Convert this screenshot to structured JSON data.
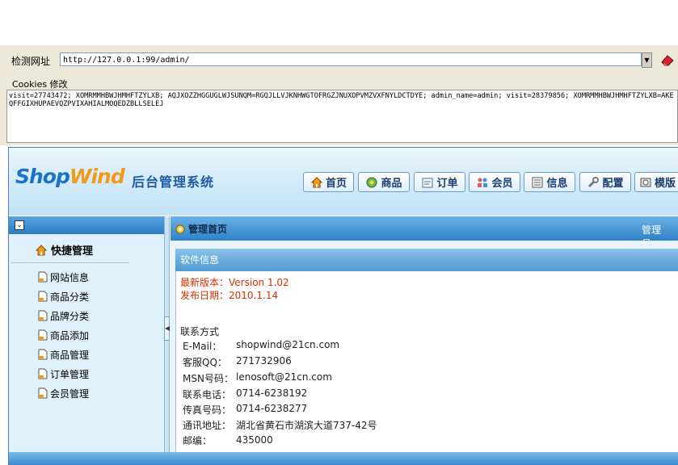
{
  "tool": {
    "url_label": "检测网址",
    "url_value": "http://127.0.0.1:99/admin/",
    "cookie_label": "Cookies 修改",
    "cookie_value": "visit=27743472; XOMRMMHBWJHMHFTZYLXB; AQJXOZZHGGUGLWJSUNQM=RGQJLLVJKNHWGTOFRGZJNUXOPVMZVXFNYLDCTDYE; admin_name=admin; visit=28379856; XOMRMMHBWJHMHFTZYLXB=AKEQFFGIXHUPAEVQZPVIXAHIALMOQEDZBLLSELEJ"
  },
  "header": {
    "logo_shop": "Shop",
    "logo_wind": "Wind",
    "system_title": "后台管理系统",
    "nav": [
      {
        "label": "首页",
        "icon": "home-icon"
      },
      {
        "label": "商品",
        "icon": "goods-icon"
      },
      {
        "label": "订单",
        "icon": "order-icon"
      },
      {
        "label": "会员",
        "icon": "members-icon"
      },
      {
        "label": "信息",
        "icon": "info-icon"
      },
      {
        "label": "配置",
        "icon": "wrench-icon"
      },
      {
        "label": "模版",
        "icon": "template-icon"
      }
    ]
  },
  "sidebar": {
    "toggle": "⊙",
    "quick_title": "快捷管理",
    "items": [
      "网站信息",
      "商品分类",
      "品牌分类",
      "商品添加",
      "商品管理",
      "订单管理",
      "会员管理"
    ]
  },
  "main": {
    "title": "管理首页",
    "admin_label": "管理员：",
    "panel_title": "软件信息",
    "version_label": "最新版本：",
    "version_value": "Version 1.02",
    "date_label": "发布日期：",
    "date_value": "2010.1.14",
    "contact_title": "联系方式",
    "contacts": [
      {
        "label": "E-Mail：",
        "value": "shopwind@21cn.com"
      },
      {
        "label": "客服QQ：",
        "value": "271732906"
      },
      {
        "label": "MSN号码：",
        "value": "lenosoft@21cn.com"
      },
      {
        "label": "联系电话：",
        "value": "0714-6238192"
      },
      {
        "label": "传真号码：",
        "value": "0714-6238277"
      },
      {
        "label": "通讯地址：",
        "value": "湖北省黄石市湖滨大道737-42号"
      },
      {
        "label": "邮编：",
        "value": "435000"
      }
    ]
  },
  "colors": {
    "accent": "#2f81c6",
    "red_text": "#d43200",
    "logo_orange": "#f29a1a"
  }
}
